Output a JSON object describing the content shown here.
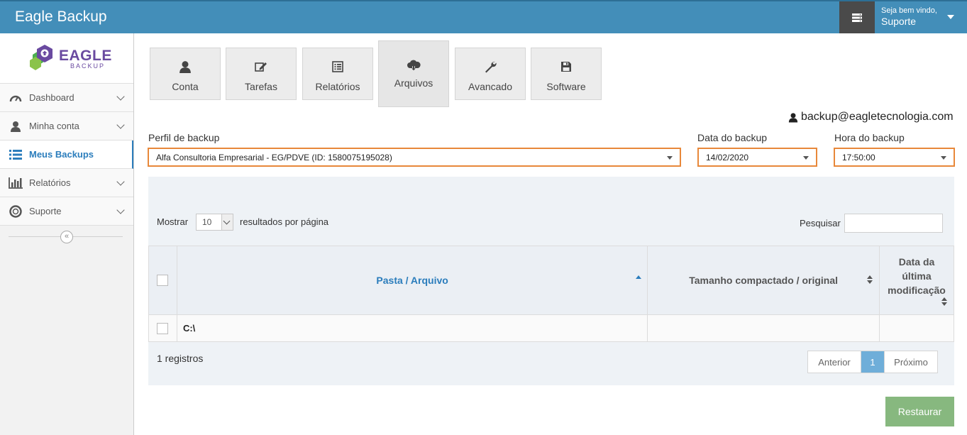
{
  "app": {
    "title": "Eagle Backup"
  },
  "user": {
    "greeting": "Seja bem vindo,",
    "name": "Suporte"
  },
  "logo": {
    "word": "EAGLE",
    "sub": "BACKUP",
    "colors": {
      "purple": "#6a4aa0",
      "green": "#4caf50"
    }
  },
  "sidebar": {
    "items": [
      {
        "label": "Dashboard",
        "icon": "dashboard-icon"
      },
      {
        "label": "Minha conta",
        "icon": "user-icon"
      },
      {
        "label": "Meus Backups",
        "icon": "list-icon",
        "active": true
      },
      {
        "label": "Relatórios",
        "icon": "bar-chart-icon"
      },
      {
        "label": "Suporte",
        "icon": "lifebuoy-icon"
      }
    ]
  },
  "tabs": [
    {
      "label": "Conta",
      "icon": "user-icon"
    },
    {
      "label": "Tarefas",
      "icon": "edit-icon"
    },
    {
      "label": "Relatórios",
      "icon": "list-alt-icon"
    },
    {
      "label": "Arquivos",
      "icon": "cloud-download-icon",
      "active": true
    },
    {
      "label": "Avancado",
      "icon": "wrench-icon"
    },
    {
      "label": "Software",
      "icon": "save-icon"
    }
  ],
  "account_email": "backup@eagletecnologia.com",
  "filters": {
    "profile_label": "Perfil de backup",
    "profile_value": "Alfa Consultoria Empresarial - EG/PDVE (ID: 1580075195028)",
    "date_label": "Data do backup",
    "date_value": "14/02/2020",
    "time_label": "Hora do backup",
    "time_value": "17:50:00"
  },
  "table": {
    "show_label": "Mostrar",
    "page_length": "10",
    "per_page_label": "resultados por página",
    "search_label": "Pesquisar",
    "columns": [
      "Pasta / Arquivo",
      "Tamanho compactado / original",
      "Data da última modificação"
    ],
    "rows": [
      {
        "path": "C:\\",
        "size": "",
        "modified": ""
      }
    ],
    "info": "1 registros",
    "pager": {
      "prev": "Anterior",
      "current": "1",
      "next": "Próximo"
    }
  },
  "actions": {
    "restore": "Restaurar"
  },
  "colors": {
    "navbar": "#438eb9",
    "highlight_border": "#e8883a",
    "restore_button": "#87b87f",
    "active_link": "#2b7dbc"
  }
}
